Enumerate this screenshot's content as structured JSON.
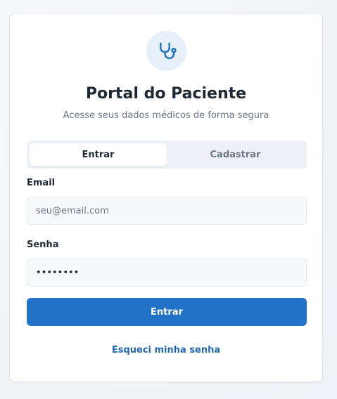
{
  "brand": {
    "logo_icon": "stethoscope-icon",
    "accent_color": "#2373c8",
    "title": "Portal do Paciente",
    "subtitle": "Acesse seus dados médicos de forma segura"
  },
  "tabs": [
    {
      "label": "Entrar",
      "active": true
    },
    {
      "label": "Cadastrar",
      "active": false
    }
  ],
  "form": {
    "email": {
      "label": "Email",
      "placeholder": "seu@email.com",
      "value": ""
    },
    "password": {
      "label": "Senha",
      "value": "password"
    },
    "submit_label": "Entrar",
    "forgot_label": "Esqueci minha senha"
  }
}
